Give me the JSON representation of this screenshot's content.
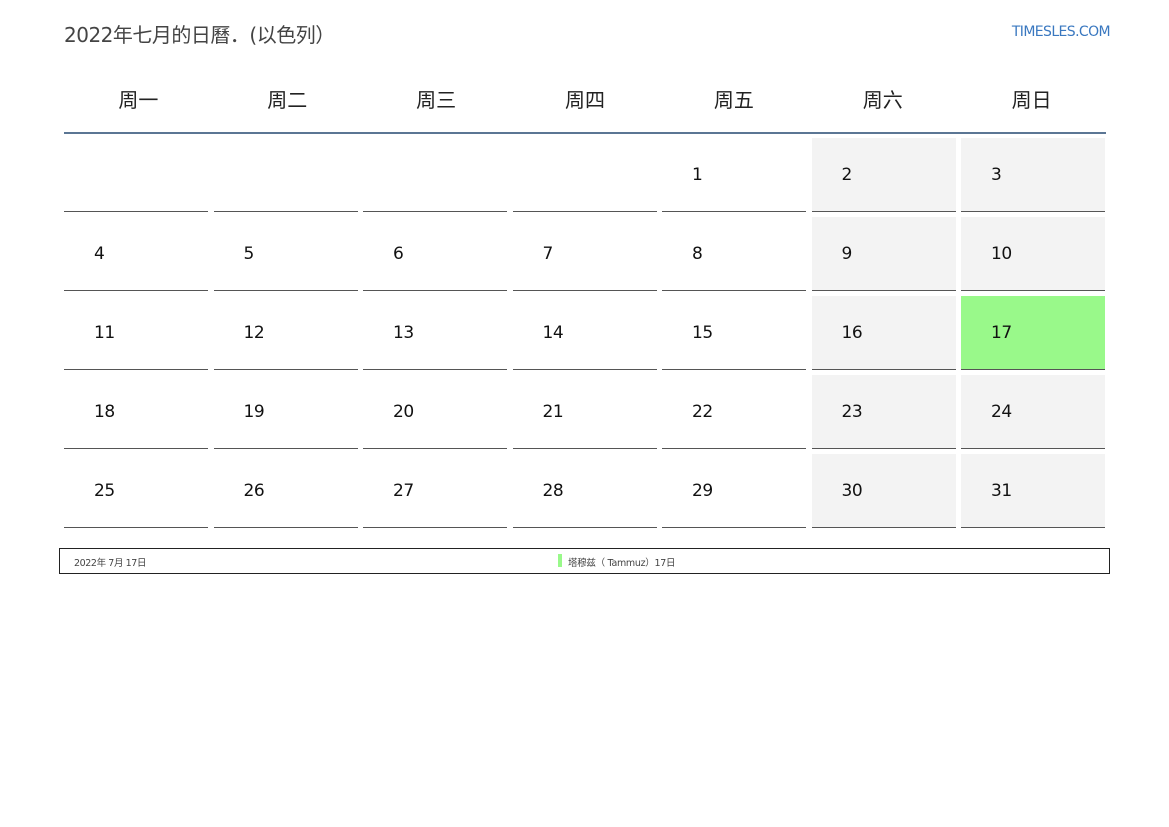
{
  "header": {
    "title": "2022年七月的日曆．(以色列）",
    "site": "TIMESLES.COM"
  },
  "weekdays": [
    "周一",
    "周二",
    "周三",
    "周四",
    "周五",
    "周六",
    "周日"
  ],
  "calendar": {
    "weeks": [
      [
        "",
        "",
        "",
        "",
        "1",
        "2",
        "3"
      ],
      [
        "4",
        "5",
        "6",
        "7",
        "8",
        "9",
        "10"
      ],
      [
        "11",
        "12",
        "13",
        "14",
        "15",
        "16",
        "17"
      ],
      [
        "18",
        "19",
        "20",
        "21",
        "22",
        "23",
        "24"
      ],
      [
        "25",
        "26",
        "27",
        "28",
        "29",
        "30",
        "31"
      ]
    ],
    "highlighted_day": "17",
    "colors": {
      "weekend": "#f3f3f3",
      "holiday": "#99f98a",
      "header_rule": "#5b7694",
      "link": "#3a78c0"
    }
  },
  "legend": {
    "date": "2022年 7月 17日",
    "event": "塔穆兹（ Tammuz）17日"
  }
}
